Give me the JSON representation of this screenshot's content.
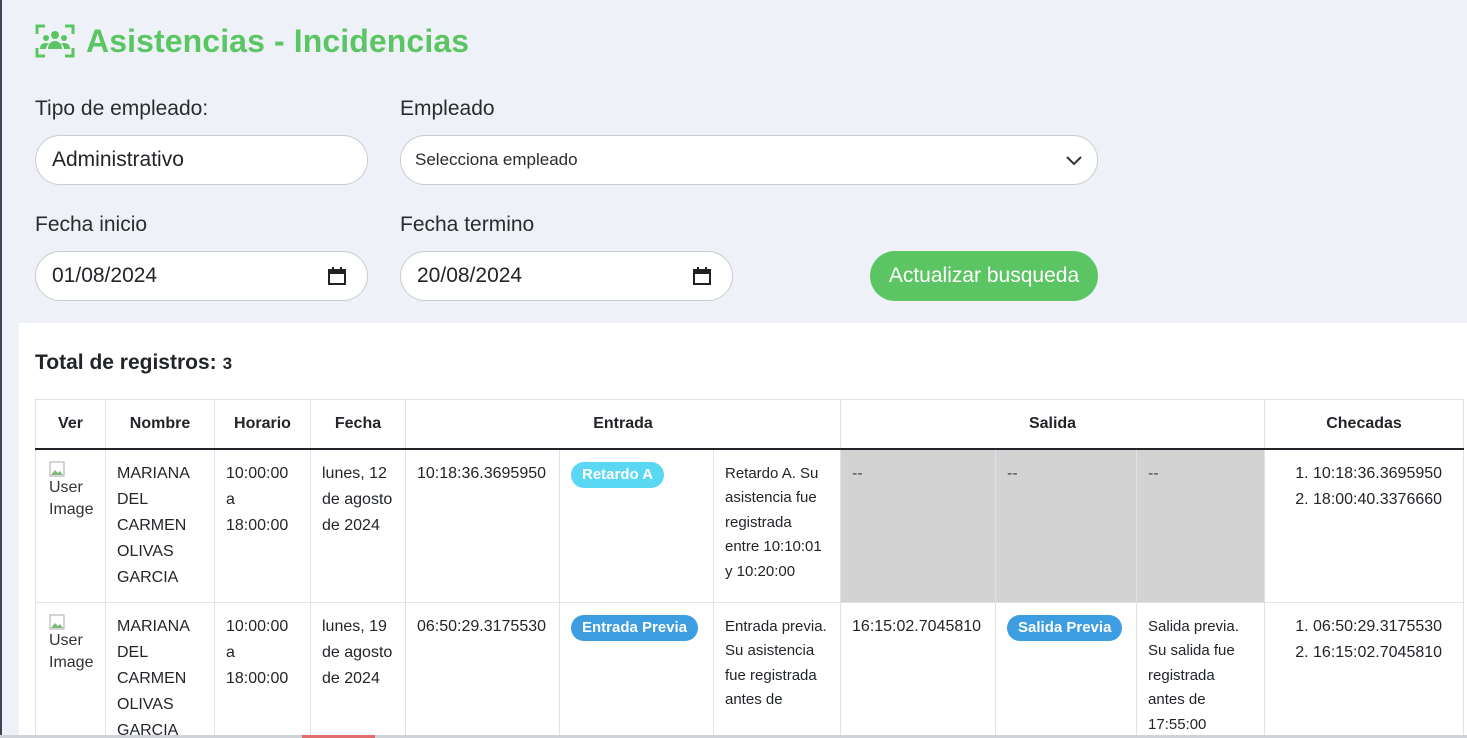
{
  "page": {
    "title": "Asistencias - Incidencias",
    "title_icon": "users-icon",
    "accent_color": "#5cc563"
  },
  "filters": {
    "tipo_label": "Tipo de empleado:",
    "tipo_value": "Administrativo",
    "empleado_label": "Empleado",
    "empleado_value": "Selecciona empleado",
    "fecha_inicio_label": "Fecha inicio",
    "fecha_inicio_value": "01/08/2024",
    "fecha_termino_label": "Fecha termino",
    "fecha_termino_value": "20/08/2024",
    "button_label": "Actualizar busqueda"
  },
  "results": {
    "total_label": "Total de registros:",
    "total_count": "3"
  },
  "table": {
    "headers": {
      "ver": "Ver",
      "nombre": "Nombre",
      "horario": "Horario",
      "fecha": "Fecha",
      "entrada": "Entrada",
      "salida": "Salida",
      "checadas": "Checadas"
    },
    "rows": [
      {
        "image_alt": "User Image",
        "nombre": "MARIANA DEL CARMEN OLIVAS GARCIA",
        "horario_inicio": "10:00:00",
        "horario_sep": "a",
        "horario_fin": "18:00:00",
        "fecha": "lunes, 12 de agosto de 2024",
        "entrada_hora": "10:18:36.3695950",
        "entrada_badge": "Retardo A",
        "entrada_msg": "Retardo A. Su asistencia fue registrada entre 10:10:01 y 10:20:00",
        "salida_hora": "--",
        "salida_badge": "--",
        "salida_msg": "--",
        "checada_1": "10:18:36.3695950",
        "checada_2": "18:00:40.3376660"
      },
      {
        "image_alt": "User Image",
        "nombre": "MARIANA DEL CARMEN OLIVAS GARCIA",
        "horario_inicio": "10:00:00",
        "horario_sep": "a",
        "horario_fin": "18:00:00",
        "fecha": "lunes, 19 de agosto de 2024",
        "entrada_hora": "06:50:29.3175530",
        "entrada_badge": "Entrada Previa",
        "entrada_msg": "Entrada previa. Su asistencia fue registrada antes de",
        "salida_hora": "16:15:02.7045810",
        "salida_badge": "Salida Previa",
        "salida_msg": "Salida previa. Su salida fue registrada antes de 17:55:00",
        "checada_1": "06:50:29.3175530",
        "checada_2": "16:15:02.7045810"
      }
    ]
  }
}
